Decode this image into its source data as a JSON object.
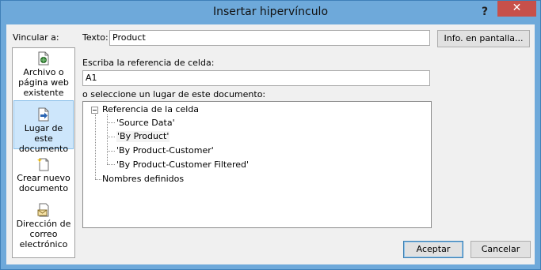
{
  "window": {
    "title": "Insertar hipervínculo",
    "help_glyph": "?",
    "close_glyph": "✕"
  },
  "sidebar": {
    "heading": "Vincular a:",
    "items": [
      {
        "label_lines": [
          "Archivo o",
          "página web",
          "existente"
        ],
        "icon": "file-web-icon",
        "selected": false
      },
      {
        "label_lines": [
          "Lugar de este",
          "documento"
        ],
        "icon": "document-place-icon",
        "selected": true
      },
      {
        "label_lines": [
          "Crear nuevo",
          "documento"
        ],
        "icon": "new-document-icon",
        "selected": false
      },
      {
        "label_lines": [
          "Dirección de",
          "correo",
          "electrónico"
        ],
        "icon": "email-icon",
        "selected": false
      }
    ]
  },
  "main": {
    "text_label": "Texto:",
    "text_value": "Product",
    "screentip_button": "Info. en pantalla...",
    "cell_ref_label": "Escriba la referencia de celda:",
    "cell_ref_value": "A1",
    "place_label": "o seleccione un lugar de este documento:",
    "tree": {
      "root": "Referencia de la celda",
      "children": [
        "'Source Data'",
        "'By Product'",
        "'By Product-Customer'",
        "'By Product-Customer Filtered'"
      ],
      "selected_child": "'By Product'",
      "second_root": "Nombres definidos"
    }
  },
  "footer": {
    "ok_label": "Aceptar",
    "cancel_label": "Cancelar"
  },
  "colors": {
    "title_bar": "#6ea9da",
    "close_button": "#c7504a",
    "selected_item": "#cde6fb"
  }
}
